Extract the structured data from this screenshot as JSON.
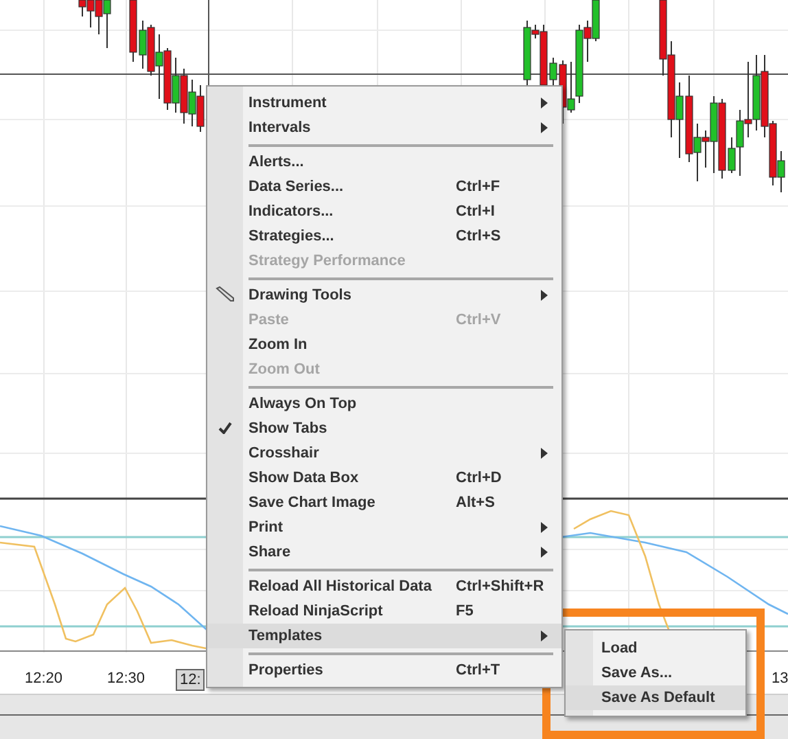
{
  "time_axis": {
    "labels": [
      {
        "text": "12:20",
        "kind": "tick"
      },
      {
        "text": "12:30",
        "kind": "tick"
      },
      {
        "text": "12:",
        "kind": "cursor"
      },
      {
        "text": "13",
        "kind": "tick"
      }
    ]
  },
  "context_menu": {
    "items": [
      {
        "kind": "item",
        "label": "Instrument",
        "submenu": true,
        "disabled": false,
        "checked": false,
        "selected": false
      },
      {
        "kind": "item",
        "label": "Intervals",
        "submenu": true,
        "disabled": false,
        "checked": false,
        "selected": false
      },
      {
        "kind": "separator"
      },
      {
        "kind": "item",
        "label": "Alerts...",
        "submenu": false,
        "disabled": false,
        "checked": false,
        "selected": false
      },
      {
        "kind": "item",
        "label": "Data Series...",
        "shortcut": "Ctrl+F",
        "submenu": false,
        "disabled": false,
        "checked": false,
        "selected": false
      },
      {
        "kind": "item",
        "label": "Indicators...",
        "shortcut": "Ctrl+I",
        "submenu": false,
        "disabled": false,
        "checked": false,
        "selected": false
      },
      {
        "kind": "item",
        "label": "Strategies...",
        "shortcut": "Ctrl+S",
        "submenu": false,
        "disabled": false,
        "checked": false,
        "selected": false
      },
      {
        "kind": "item",
        "label": "Strategy Performance",
        "submenu": false,
        "disabled": true,
        "checked": false,
        "selected": false
      },
      {
        "kind": "separator"
      },
      {
        "kind": "icon_item",
        "label": "Drawing Tools",
        "submenu": true,
        "disabled": false,
        "checked": false,
        "selected": false
      },
      {
        "kind": "item",
        "label": "Paste",
        "shortcut": "Ctrl+V",
        "submenu": false,
        "disabled": true,
        "checked": false,
        "selected": false
      },
      {
        "kind": "item",
        "label": "Zoom In",
        "submenu": false,
        "disabled": false,
        "checked": false,
        "selected": false
      },
      {
        "kind": "item",
        "label": "Zoom Out",
        "submenu": false,
        "disabled": true,
        "checked": false,
        "selected": false
      },
      {
        "kind": "separator"
      },
      {
        "kind": "item",
        "label": "Always On Top",
        "submenu": false,
        "disabled": false,
        "checked": false,
        "selected": false
      },
      {
        "kind": "item",
        "label": "Show Tabs",
        "submenu": false,
        "disabled": false,
        "checked": true,
        "selected": false
      },
      {
        "kind": "item",
        "label": "Crosshair",
        "submenu": true,
        "disabled": false,
        "checked": false,
        "selected": false
      },
      {
        "kind": "item",
        "label": "Show Data Box",
        "shortcut": "Ctrl+D",
        "submenu": false,
        "disabled": false,
        "checked": false,
        "selected": false
      },
      {
        "kind": "item",
        "label": "Save Chart Image",
        "shortcut": "Alt+S",
        "submenu": false,
        "disabled": false,
        "checked": false,
        "selected": false
      },
      {
        "kind": "item",
        "label": "Print",
        "submenu": true,
        "disabled": false,
        "checked": false,
        "selected": false
      },
      {
        "kind": "item",
        "label": "Share",
        "submenu": true,
        "disabled": false,
        "checked": false,
        "selected": false
      },
      {
        "kind": "separator"
      },
      {
        "kind": "item",
        "label": "Reload All Historical Data",
        "shortcut": "Ctrl+Shift+R",
        "submenu": false,
        "disabled": false,
        "checked": false,
        "selected": false
      },
      {
        "kind": "item",
        "label": "Reload NinjaScript",
        "shortcut": "F5",
        "submenu": false,
        "disabled": false,
        "checked": false,
        "selected": false
      },
      {
        "kind": "item",
        "label": "Templates",
        "submenu": true,
        "disabled": false,
        "checked": false,
        "selected": true
      },
      {
        "kind": "separator"
      },
      {
        "kind": "item",
        "label": "Properties",
        "shortcut": "Ctrl+T",
        "submenu": false,
        "disabled": false,
        "checked": false,
        "selected": false
      }
    ]
  },
  "templates_submenu": {
    "items": [
      {
        "label": "Load",
        "selected": false
      },
      {
        "label": "Save As...",
        "selected": false
      },
      {
        "label": "Save As Default",
        "selected": true
      }
    ]
  }
}
